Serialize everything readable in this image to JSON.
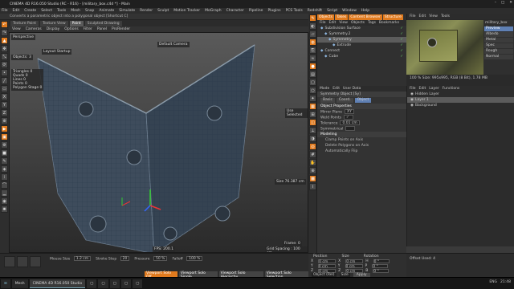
{
  "window": {
    "title": "CINEMA 4D R16.050 Studio (RC - R16) - [military_box.c4d *] - Main",
    "controls": [
      "–",
      "□",
      "✕"
    ]
  },
  "menubar": {
    "items": [
      "File",
      "Edit",
      "Create",
      "Select",
      "Tools",
      "Mesh",
      "Snap",
      "Animate",
      "Simulate",
      "Render",
      "Sculpt",
      "Motion Tracker",
      "MoGraph",
      "Character",
      "Pipeline",
      "Plugins",
      "PCS Tools",
      "Redshift",
      "Script",
      "Window",
      "Help"
    ]
  },
  "infobar": {
    "text": "Converts a parametric object into a polygonal object [Shortcut C]"
  },
  "viewport": {
    "tabs": [
      "Texture Paint",
      "Texture View",
      "Paint",
      "Sculpted Drawing"
    ],
    "active_tab": "Paint",
    "menu": [
      "View",
      "Cameras",
      "Display",
      "Options",
      "Filter",
      "Panel",
      "ProRender"
    ],
    "perspective_label": "Perspective",
    "layout_label": "Layout Startup",
    "hud_objects": "Objects: 3",
    "hud_stats": [
      "Triangles  0",
      "Quads  0",
      "Lines  0",
      "Points  0",
      "Polygon Stage 0"
    ],
    "label_right_top": "Default Camera",
    "label_right_mid": "Use Selected",
    "label_right_low": "Size  76.387 cm",
    "fps": "FPS: 200.1",
    "frame_label": "Frame: 0",
    "grid_spacing": "Grid Spacing : 100 cm"
  },
  "object_manager": {
    "menu": [
      "File",
      "Edit",
      "View",
      "Objects",
      "Tags",
      "Bookmarks"
    ],
    "tabs": [
      "Objects",
      "Takes",
      "Content Browser",
      "Structure"
    ],
    "objects": [
      {
        "name": "Subdivision Surface",
        "selected": false,
        "indent": 0
      },
      {
        "name": "Symmetry.2",
        "selected": false,
        "indent": 1
      },
      {
        "name": "Symmetry",
        "selected": true,
        "indent": 2
      },
      {
        "name": "Extrude",
        "selected": false,
        "indent": 3
      },
      {
        "name": "Connect",
        "selected": false,
        "indent": 0
      },
      {
        "name": "Cube",
        "selected": false,
        "indent": 1
      }
    ]
  },
  "attributes": {
    "menu": [
      "Mode",
      "Edit",
      "User Data"
    ],
    "object_title": "Symmetry Object [Sy]",
    "tabs": [
      "Basic",
      "Coord.",
      "Object"
    ],
    "active_tab": "Object",
    "section_title": "Object Properties",
    "properties": [
      {
        "label": "Mirror Plane",
        "value": "XY"
      },
      {
        "label": "Weld Points",
        "value": "✓"
      },
      {
        "label": "Tolerance",
        "value": "0.01 cm"
      },
      {
        "label": "Symmetrical",
        "value": ""
      }
    ],
    "modeling_section": "Modeling",
    "modeling_props": [
      "Clamp Points on Axis",
      "Delete Polygons on Axis",
      "Automatically Flip"
    ]
  },
  "material_preview": {
    "menu": [
      "File",
      "Edit",
      "View",
      "Tools"
    ],
    "texture_label": "military_box",
    "buttons": [
      "Preview",
      "Albedo",
      "Metal",
      "Spec",
      "Rough",
      "Normal"
    ],
    "active_button": "Preview",
    "info": "100 % Size: 995x995, RGB (8 Bit), 1.78 MB"
  },
  "layers": {
    "menu": [
      "File",
      "Edit",
      "Layer",
      "Functions"
    ],
    "hints": [
      "Hidden Layer",
      "Layer 1",
      "Background"
    ]
  },
  "timeline": {
    "brush_count": 12,
    "labels": [
      {
        "label": "Mouse Size",
        "value": "1.2 cm"
      },
      {
        "label": "Stroke Step",
        "value": "20"
      },
      {
        "label": "Pressure",
        "value": "50 %"
      },
      {
        "label": "Falloff",
        "value": "100 %"
      }
    ],
    "tabs": [
      "Viewport Solo Off",
      "Viewport Solo Single",
      "Viewport Solo Hierarchy",
      "Viewport Solo Selection"
    ]
  },
  "coordinates": {
    "headers": [
      "Position",
      "Size",
      "Rotation"
    ],
    "rows": [
      {
        "axis": "X",
        "pos": "0 cm",
        "size": "0 cm",
        "rotlabel": "H",
        "rot": "0 °"
      },
      {
        "axis": "Y",
        "pos": "0 cm",
        "size": "0 cm",
        "rotlabel": "P",
        "rot": "0 °"
      },
      {
        "axis": "Z",
        "pos": "0 cm",
        "size": "0 cm",
        "rotlabel": "B",
        "rot": "0 °"
      }
    ],
    "mode_object": "Object (Rel)",
    "mode_size": "Size",
    "apply": "Apply"
  },
  "status": {
    "text": "Offset Used: 4"
  },
  "taskbar": {
    "tasks": [
      "Mesh",
      "CINEMA 4D R16.050 Studio",
      "",
      "",
      "",
      "",
      ""
    ],
    "active_index": 1,
    "clock": "21:48",
    "lang": "ENG"
  },
  "colors": {
    "accent": "#e07a1e",
    "selection": "#5c5c5c",
    "bg": "#3a3a3a"
  }
}
